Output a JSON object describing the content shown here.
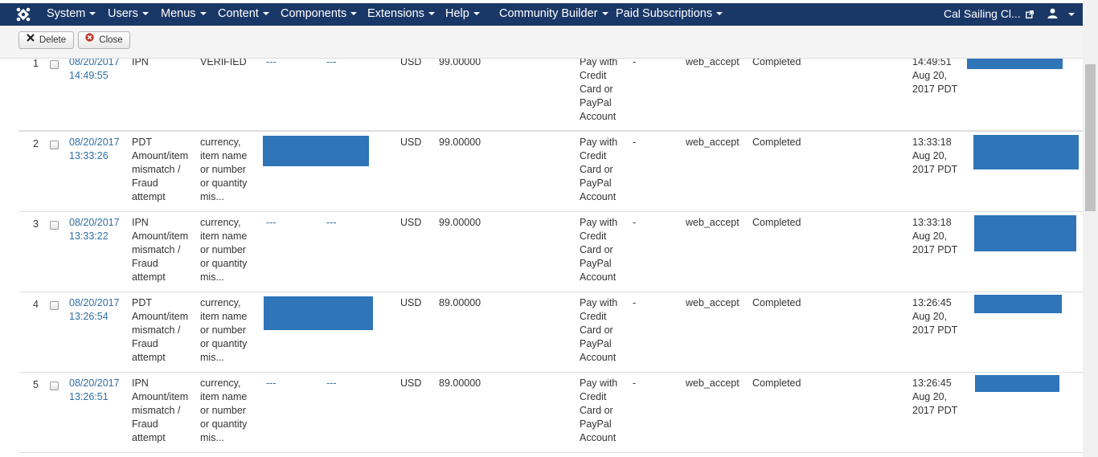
{
  "nav": {
    "items": [
      "System",
      "Users",
      "Menus",
      "Content",
      "Components",
      "Extensions",
      "Help",
      "Community Builder",
      "Paid Subscriptions"
    ],
    "site_link": "Cal Sailing Cl...",
    "bg_color": "#1a3867"
  },
  "toolbar": {
    "delete_label": "Delete",
    "close_label": "Close"
  },
  "table": {
    "rows": [
      {
        "num": "1",
        "date": [
          "08/20/2017",
          "14:49:55"
        ],
        "type": [
          "IPN"
        ],
        "message": [
          "VERIFIED"
        ],
        "payer": [
          "---",
          "---"
        ],
        "currency": "USD",
        "amount": "99.00000",
        "payment": [
          "Pay with",
          "Credit",
          "Card or",
          "PayPal",
          "Account"
        ],
        "hyphen": "-",
        "txn_type": "web_accept",
        "status": "Completed",
        "time": [
          "14:49:51",
          "Aug 20,",
          "2017 PDT"
        ]
      },
      {
        "num": "2",
        "date": [
          "08/20/2017",
          "13:33:26"
        ],
        "type": [
          "PDT",
          "Amount/item",
          "mismatch /",
          "Fraud",
          "attempt"
        ],
        "message": [
          "currency,",
          "item name",
          "or number",
          "or quantity",
          "mis..."
        ],
        "payer": [],
        "currency": "USD",
        "amount": "99.00000",
        "payment": [
          "Pay with",
          "Credit",
          "Card or",
          "PayPal",
          "Account"
        ],
        "hyphen": "-",
        "txn_type": "web_accept",
        "status": "Completed",
        "time": [
          "13:33:18",
          "Aug 20,",
          "2017 PDT"
        ]
      },
      {
        "num": "3",
        "date": [
          "08/20/2017",
          "13:33:22"
        ],
        "type": [
          "IPN",
          "Amount/item",
          "mismatch /",
          "Fraud",
          "attempt"
        ],
        "message": [
          "currency,",
          "item name",
          "or number",
          "or quantity",
          "mis..."
        ],
        "payer": [
          "---",
          "---"
        ],
        "currency": "USD",
        "amount": "99.00000",
        "payment": [
          "Pay with",
          "Credit",
          "Card or",
          "PayPal",
          "Account"
        ],
        "hyphen": "-",
        "txn_type": "web_accept",
        "status": "Completed",
        "time": [
          "13:33:18",
          "Aug 20,",
          "2017 PDT"
        ]
      },
      {
        "num": "4",
        "date": [
          "08/20/2017",
          "13:26:54"
        ],
        "type": [
          "PDT",
          "Amount/item",
          "mismatch /",
          "Fraud",
          "attempt"
        ],
        "message": [
          "currency,",
          "item name",
          "or number",
          "or quantity",
          "mis..."
        ],
        "payer": [],
        "currency": "USD",
        "amount": "89.00000",
        "payment": [
          "Pay with",
          "Credit",
          "Card or",
          "PayPal",
          "Account"
        ],
        "hyphen": "-",
        "txn_type": "web_accept",
        "status": "Completed",
        "time": [
          "13:26:45",
          "Aug 20,",
          "2017 PDT"
        ]
      },
      {
        "num": "5",
        "date": [
          "08/20/2017",
          "13:26:51"
        ],
        "type": [
          "IPN",
          "Amount/item",
          "mismatch /",
          "Fraud",
          "attempt"
        ],
        "message": [
          "currency,",
          "item name",
          "or number",
          "or quantity",
          "mis..."
        ],
        "payer": [
          "---",
          "---"
        ],
        "currency": "USD",
        "amount": "89.00000",
        "payment": [
          "Pay with",
          "Credit",
          "Card or",
          "PayPal",
          "Account"
        ],
        "hyphen": "-",
        "txn_type": "web_accept",
        "status": "Completed",
        "time": [
          "13:26:45",
          "Aug 20,",
          "2017 PDT"
        ]
      }
    ]
  },
  "colors": {
    "link": "#2f6ea3",
    "redaction": "#2f75b8"
  },
  "icons": [
    "joomla-logo-icon",
    "external-link-icon",
    "user-icon",
    "delete-x-icon",
    "close-circle-icon"
  ]
}
